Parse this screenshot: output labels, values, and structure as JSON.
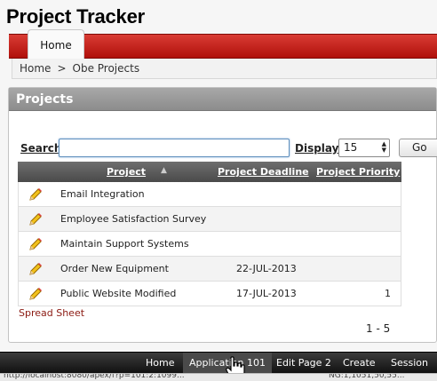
{
  "app": {
    "title": "Project Tracker"
  },
  "nav": {
    "tabs": [
      {
        "label": "Home"
      }
    ]
  },
  "breadcrumb": {
    "items": [
      "Home",
      "Obe Projects"
    ],
    "separator": ">"
  },
  "region": {
    "title": "Projects"
  },
  "search": {
    "label": "Search",
    "value": "",
    "display_label": "Display",
    "display_value": "15",
    "go_label": "Go"
  },
  "table": {
    "columns": [
      "Project",
      "Project Deadline",
      "Project Priority"
    ],
    "sort_indicator": "▲",
    "rows": [
      {
        "project": "Email Integration",
        "deadline": "",
        "priority": ""
      },
      {
        "project": "Employee Satisfaction Survey",
        "deadline": "",
        "priority": ""
      },
      {
        "project": "Maintain Support Systems",
        "deadline": "",
        "priority": ""
      },
      {
        "project": "Order New Equipment",
        "deadline": "22-JUL-2013",
        "priority": ""
      },
      {
        "project": "Public Website Modified",
        "deadline": "17-JUL-2013",
        "priority": "1"
      }
    ]
  },
  "links": {
    "spreadsheet": "Spread Sheet"
  },
  "pagination": {
    "range": "1 - 5"
  },
  "devbar": {
    "items": [
      "Home",
      "Application 101",
      "Edit Page 2",
      "Create",
      "Session"
    ],
    "active_index": 1
  },
  "statusbar": {
    "left": "http://localhost:8080/apex/f?p=101:2:1099...",
    "right": "NG:1,1051,50,55..."
  },
  "colors": {
    "accent": "#c4201a",
    "link": "#8b1a12",
    "header": "#4a4a4a"
  }
}
